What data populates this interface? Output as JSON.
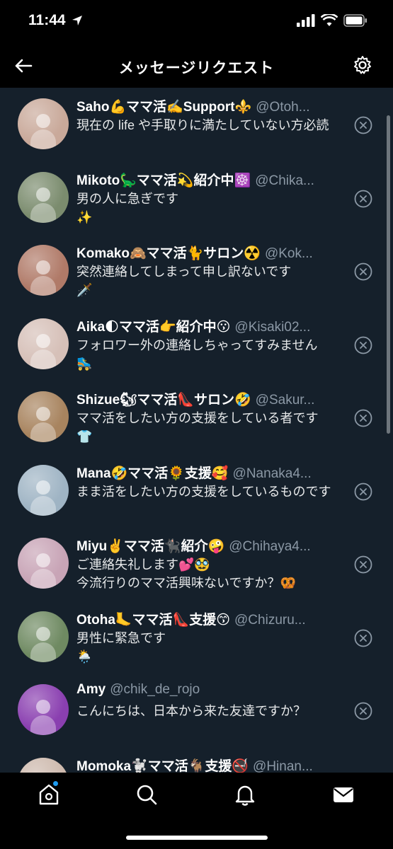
{
  "status": {
    "time": "11:44"
  },
  "header": {
    "title": "メッセージリクエスト"
  },
  "icons": {
    "back": "arrow-left-icon",
    "settings": "gear-icon",
    "dismiss": "x-circle-icon",
    "tabs": [
      "home-icon",
      "search-icon",
      "bell-icon",
      "mail-icon"
    ]
  },
  "requests": [
    {
      "name": "Saho💪ママ活✍️Support⚜️",
      "handle": "@Otoh...",
      "message": "現在の life や手取りに満たしていない方必読",
      "avatar_color": "#c9a99a"
    },
    {
      "name": "Mikoto🦕ママ活💫紹介中☸️",
      "handle": "@Chika...",
      "message": "男の人に急ぎです\n✨",
      "avatar_color": "#7b8c6e"
    },
    {
      "name": "Komako🙈ママ活🐈サロン☢️",
      "handle": "@Kok...",
      "message": "突然連絡してしまって申し訳ないです\n🗡️",
      "avatar_color": "#b07a68"
    },
    {
      "name": "Aika🌓ママ活👉紹介中😗",
      "handle": "@Kisaki02...",
      "message": "フォロワー外の連絡しちゃってすみません\n🛼",
      "avatar_color": "#d6c0b8"
    },
    {
      "name": "Shizue🐿ママ活👠サロン🤣",
      "handle": "@Sakur...",
      "message": "ママ活をしたい方の支援をしている者です\n👕",
      "avatar_color": "#a8845f"
    },
    {
      "name": "Mana🤣ママ活🌻支援🥰",
      "handle": "@Nanaka4...",
      "message": "まま活をしたい方の支援をしているものです",
      "avatar_color": "#9fb4c4"
    },
    {
      "name": "Miyu✌️ママ活🐈‍⬛紹介🤪",
      "handle": "@Chihaya4...",
      "message": "ご連絡失礼します💕🥸\n今流行りのママ活興味ないですか？🥨",
      "avatar_color": "#c8a4b6"
    },
    {
      "name": "Otoha🦶ママ活👠支援😙",
      "handle": "@Chizuru...",
      "message": "男性に緊急です\n🌦️",
      "avatar_color": "#6f8a62"
    },
    {
      "name": "Amy",
      "handle": "@chik_de_rojo",
      "message": "こんにちは、日本から来た友達ですか？",
      "avatar_color": "#8a3fb0"
    },
    {
      "name": "Momoka🐩ママ活🐐支援🚭",
      "handle": "@Hinan...",
      "message": "",
      "avatar_color": "#cdb9ad"
    }
  ]
}
